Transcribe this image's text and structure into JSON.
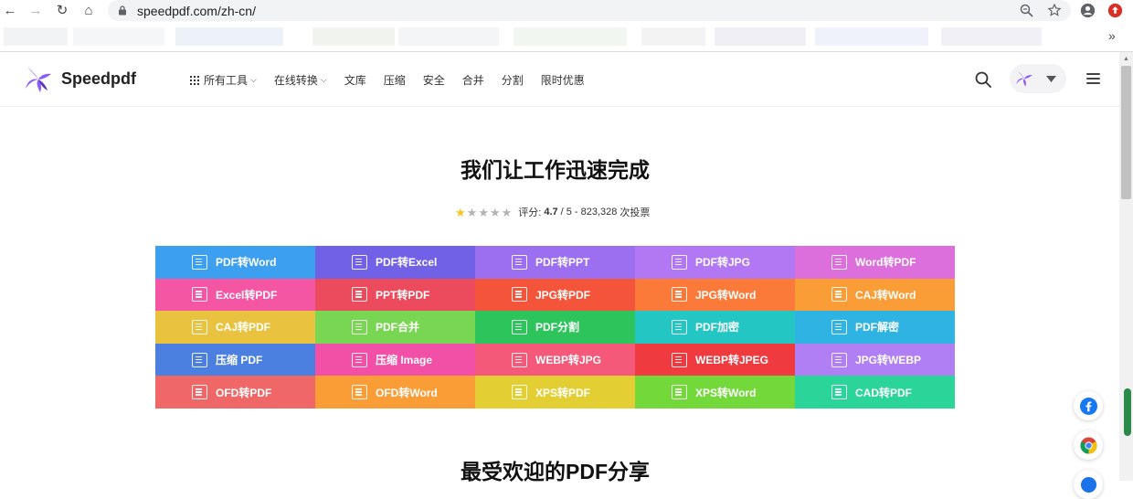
{
  "browser": {
    "url": "speedpdf.com/zh-cn/",
    "bookmarks_overflow": "»"
  },
  "header": {
    "brand": "Speedpdf",
    "menu": [
      {
        "label": "所有工具",
        "has_grid_icon": true,
        "has_chevron": true
      },
      {
        "label": "在线转换",
        "has_chevron": true
      },
      {
        "label": "文库"
      },
      {
        "label": "压缩"
      },
      {
        "label": "安全"
      },
      {
        "label": "合并"
      },
      {
        "label": "分割"
      },
      {
        "label": "限时优惠"
      }
    ],
    "chevron": "⌵"
  },
  "hero": {
    "title": "我们让工作迅速完成",
    "rating": {
      "stars_filled": 1,
      "stars_total": 5,
      "label": "评分:",
      "score": "4.7",
      "scale": "/ 5 -",
      "votes": "823,328",
      "votes_suffix": "次投票"
    }
  },
  "tools": [
    {
      "label": "PDF转Word",
      "color": "#3d9ff0"
    },
    {
      "label": "PDF转Excel",
      "color": "#7161e6"
    },
    {
      "label": "PDF转PPT",
      "color": "#9b6ff0"
    },
    {
      "label": "PDF转JPG",
      "color": "#b277f2"
    },
    {
      "label": "Word转PDF",
      "color": "#dc6fdc"
    },
    {
      "label": "Excel转PDF",
      "color": "#f456a4"
    },
    {
      "label": "PPT转PDF",
      "color": "#eb4b5c"
    },
    {
      "label": "JPG转PDF",
      "color": "#f4543a"
    },
    {
      "label": "JPG转Word",
      "color": "#fb7a39"
    },
    {
      "label": "CAJ转Word",
      "color": "#fb9d36"
    },
    {
      "label": "CAJ转PDF",
      "color": "#e9c33f"
    },
    {
      "label": "PDF合并",
      "color": "#79d652"
    },
    {
      "label": "PDF分割",
      "color": "#2dc55b"
    },
    {
      "label": "PDF加密",
      "color": "#24c6c4"
    },
    {
      "label": "PDF解密",
      "color": "#2eb3e2"
    },
    {
      "label": "压缩 PDF",
      "color": "#4b7fe0"
    },
    {
      "label": "压缩 Image",
      "color": "#f150a6"
    },
    {
      "label": "WEBP转JPG",
      "color": "#f4597a"
    },
    {
      "label": "WEBP转JPEG",
      "color": "#ef3a3f"
    },
    {
      "label": "JPG转WEBP",
      "color": "#b07ff3"
    },
    {
      "label": "OFD转PDF",
      "color": "#f06767"
    },
    {
      "label": "OFD转Word",
      "color": "#fb9d37"
    },
    {
      "label": "XPS转PDF",
      "color": "#e3cf33"
    },
    {
      "label": "XPS转Word",
      "color": "#73d93a"
    },
    {
      "label": "CAD转PDF",
      "color": "#2bd59a"
    }
  ],
  "section": {
    "title": "最受欢迎的PDF分享"
  },
  "colors": {
    "brand_purple": "#8b5cf6",
    "star_filled": "#f5c518",
    "star_empty": "#b3b3b3",
    "facebook": "#1877f2"
  }
}
